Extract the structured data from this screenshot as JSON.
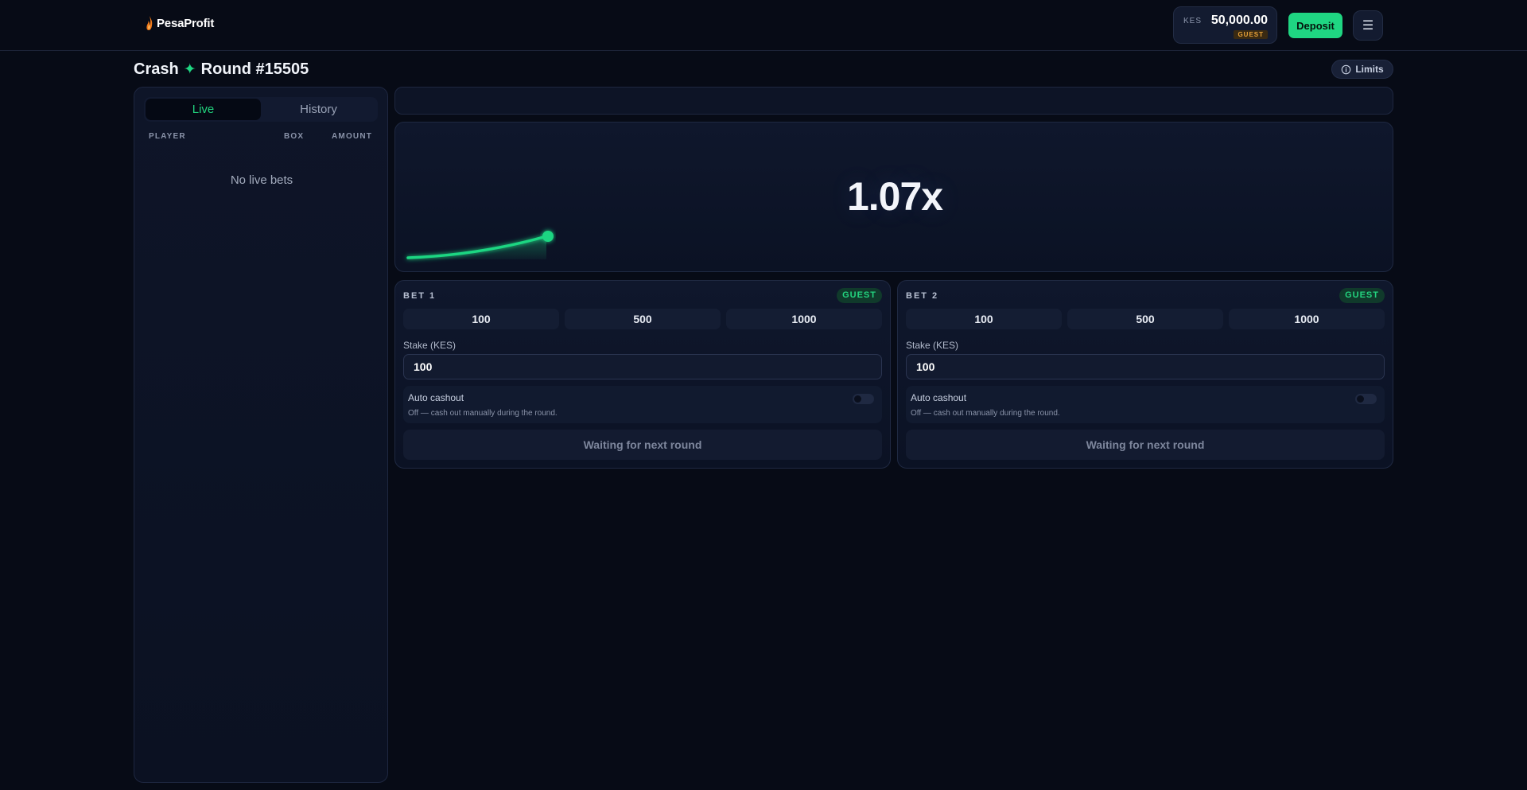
{
  "brand": {
    "name": "PesaProfit",
    "logo_icon": "flame-icon"
  },
  "wallet": {
    "currency": "KES",
    "balance": "50,000.00",
    "badge": "GUEST"
  },
  "header": {
    "deposit_label": "Deposit",
    "menu_icon": "hamburger-menu-icon",
    "menu_glyph": "☰"
  },
  "page": {
    "game_name": "Crash",
    "sparkle": "✦",
    "round_label": "Round #15505",
    "limits_label": "Limits",
    "limits_icon": "info-icon"
  },
  "bets_panel": {
    "tabs": [
      {
        "label": "Live",
        "active": true
      },
      {
        "label": "History",
        "active": false
      }
    ],
    "columns": [
      "PLAYER",
      "BOX",
      "AMOUNT"
    ],
    "empty_text": "No live bets"
  },
  "game": {
    "multiplier": "1.07x",
    "accent_color": "#1fd682"
  },
  "bet_boxes": [
    {
      "title": "BET 1",
      "badge": "GUEST",
      "quick_amounts": [
        "100",
        "500",
        "1000"
      ],
      "stake_label": "Stake (KES)",
      "stake_value": "100",
      "auto_cashout_label": "Auto cashout",
      "auto_cashout_desc": "Off — cash out manually during the round.",
      "auto_cashout_enabled": false,
      "action_label": "Waiting for next round"
    },
    {
      "title": "BET 2",
      "badge": "GUEST",
      "quick_amounts": [
        "100",
        "500",
        "1000"
      ],
      "stake_label": "Stake (KES)",
      "stake_value": "100",
      "auto_cashout_label": "Auto cashout",
      "auto_cashout_desc": "Off — cash out manually during the round.",
      "auto_cashout_enabled": false,
      "action_label": "Waiting for next round"
    }
  ]
}
